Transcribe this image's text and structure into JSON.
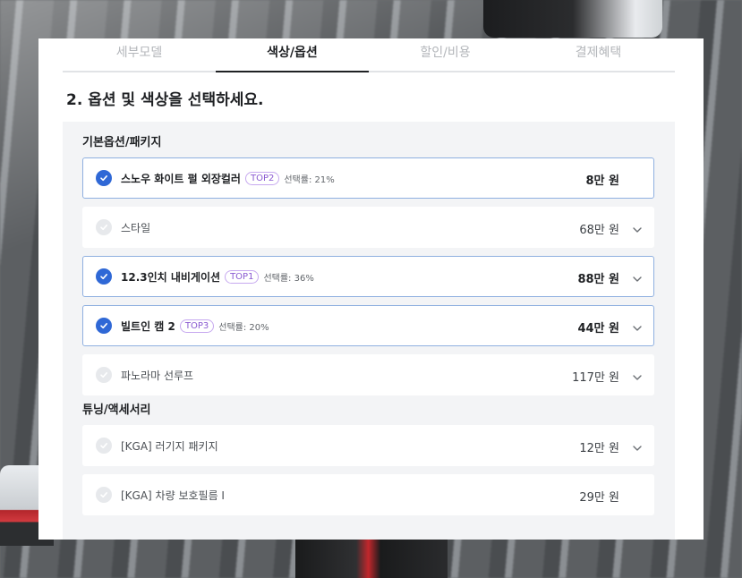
{
  "tabs": [
    {
      "label": "세부모델",
      "active": false
    },
    {
      "label": "색상/옵션",
      "active": true
    },
    {
      "label": "할인/비용",
      "active": false
    },
    {
      "label": "결제혜택",
      "active": false
    }
  ],
  "section_title": "2. 옵션 및 색상을 선택하세요.",
  "groups": [
    {
      "title": "기본옵션/패키지",
      "options": [
        {
          "name": "스노우 화이트 펄 외장컬러",
          "badge": "TOP2",
          "rate": "선택률: 21%",
          "price": "8만 원",
          "selected": true,
          "expandable": false
        },
        {
          "name": "스타일",
          "badge": "",
          "rate": "",
          "price": "68만 원",
          "selected": false,
          "expandable": true
        },
        {
          "name": "12.3인치 내비게이션",
          "badge": "TOP1",
          "rate": "선택률: 36%",
          "price": "88만 원",
          "selected": true,
          "expandable": true
        },
        {
          "name": "빌트인 캠 2",
          "badge": "TOP3",
          "rate": "선택률: 20%",
          "price": "44만 원",
          "selected": true,
          "expandable": true
        },
        {
          "name": "파노라마 선루프",
          "badge": "",
          "rate": "",
          "price": "117만 원",
          "selected": false,
          "expandable": true
        }
      ]
    },
    {
      "title": "튜닝/액세서리",
      "options": [
        {
          "name": "[KGA] 러기지 패키지",
          "badge": "",
          "rate": "",
          "price": "12만 원",
          "selected": false,
          "expandable": true
        },
        {
          "name": "[KGA] 차량 보호필름 I",
          "badge": "",
          "rate": "",
          "price": "29만 원",
          "selected": false,
          "expandable": false
        }
      ]
    }
  ],
  "icons": {
    "check": "check-icon",
    "chevron": "chevron-down-icon"
  },
  "colors": {
    "accent": "#2f68d6",
    "badge": "#8a5ad1",
    "selected_border": "#8fb0e0"
  }
}
